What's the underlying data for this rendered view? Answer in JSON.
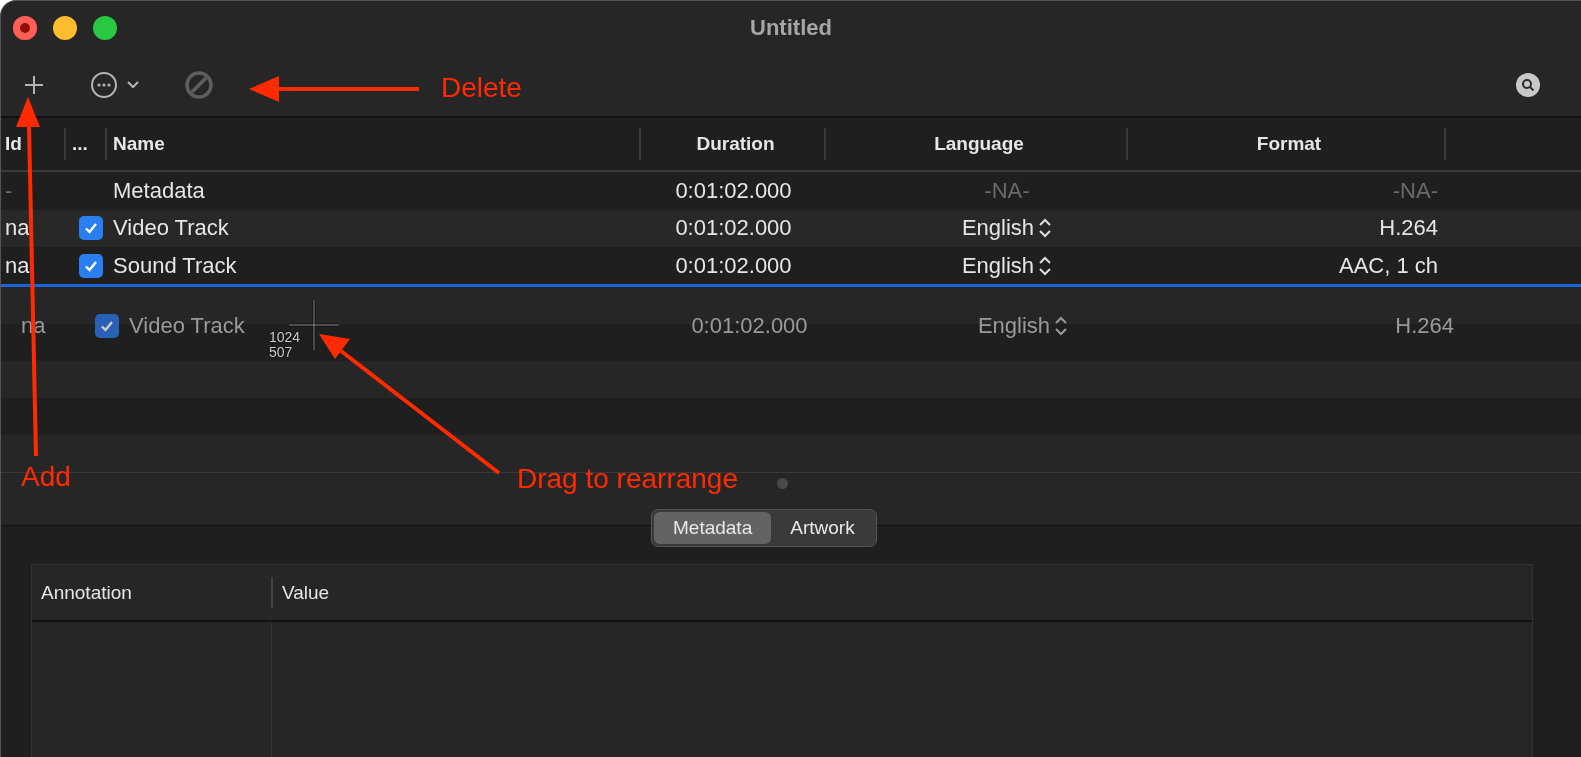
{
  "window": {
    "title": "Untitled"
  },
  "table": {
    "columns": [
      {
        "label": "Id"
      },
      {
        "label": "..."
      },
      {
        "label": "Name"
      },
      {
        "label": "Duration"
      },
      {
        "label": "Language"
      },
      {
        "label": "Format"
      }
    ],
    "rows": [
      {
        "kind": "metadata",
        "id": "-",
        "name": "Metadata",
        "duration": "0:01:02.000",
        "language": "-NA-",
        "format": "-NA-"
      },
      {
        "kind": "track",
        "id": "na",
        "checked": true,
        "name": "Video Track",
        "duration": "0:01:02.000",
        "language": "English",
        "format": "H.264"
      },
      {
        "kind": "track",
        "id": "na",
        "checked": true,
        "name": "Sound Track",
        "duration": "0:01:02.000",
        "language": "English",
        "format": "AAC, 1 ch"
      }
    ]
  },
  "drag_row": {
    "id": "na",
    "checked": true,
    "name": "Video Track",
    "duration": "0:01:02.000",
    "language": "English",
    "format": "H.264"
  },
  "cursor_readout": [
    "1024",
    "507"
  ],
  "annotations": [
    {
      "text": "Delete"
    },
    {
      "text": "Add"
    },
    {
      "text": "Drag to rearrange"
    }
  ],
  "tabs": [
    {
      "label": "Metadata",
      "selected": true
    },
    {
      "label": "Artwork",
      "selected": false
    }
  ],
  "metadata_table": {
    "columns": [
      "Annotation",
      "Value"
    ]
  }
}
